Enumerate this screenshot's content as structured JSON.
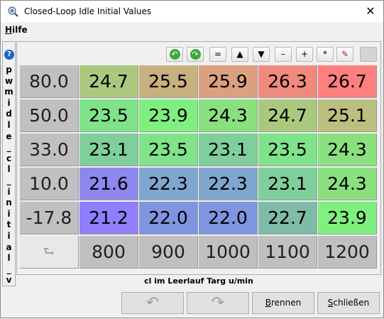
{
  "window": {
    "title": "Closed-Loop Idle Initial Values",
    "close_glyph": "✕",
    "app_icon": "gear-search-icon"
  },
  "menu": {
    "help_label": "Hilfe",
    "help_mnemonic": "H"
  },
  "sidebar": {
    "help_glyph": "?",
    "vertical_label": "pwmidle_cl_initial_values",
    "visible_chars": [
      "p",
      "w",
      "m",
      "i",
      "d",
      "l",
      "e",
      "_",
      "c",
      "l",
      "_",
      "i",
      "n",
      "i",
      "t",
      "i",
      "a",
      "l",
      "_",
      "v"
    ]
  },
  "toolbar": {
    "buttons": [
      {
        "name": "undo-green-icon",
        "glyph": "↶"
      },
      {
        "name": "redo-green-icon",
        "glyph": "↷"
      },
      {
        "name": "set-equal-button",
        "glyph": "="
      },
      {
        "name": "increase-button",
        "glyph": "▲"
      },
      {
        "name": "decrease-button",
        "glyph": "▼"
      },
      {
        "name": "subtract-button",
        "glyph": "–"
      },
      {
        "name": "add-button",
        "glyph": "+"
      },
      {
        "name": "multiply-button",
        "glyph": "*"
      },
      {
        "name": "interpolate-icon",
        "glyph": "✎"
      },
      {
        "name": "disabled-box",
        "glyph": ""
      }
    ]
  },
  "table": {
    "y_axis": [
      "80.0",
      "50.0",
      "33.0",
      "10.0",
      "-17.8"
    ],
    "x_axis": [
      "800",
      "900",
      "1000",
      "1100",
      "1200"
    ],
    "values": [
      [
        "24.7",
        "25.5",
        "25.9",
        "26.3",
        "26.7"
      ],
      [
        "23.5",
        "23.9",
        "24.3",
        "24.7",
        "25.1"
      ],
      [
        "23.1",
        "23.5",
        "23.1",
        "23.5",
        "24.3"
      ],
      [
        "21.6",
        "22.3",
        "22.3",
        "23.1",
        "24.3"
      ],
      [
        "21.2",
        "22.0",
        "22.0",
        "22.7",
        "23.9"
      ]
    ],
    "colors": [
      [
        "#aac97f",
        "#c8b07f",
        "#dba07f",
        "#f08a7f",
        "#ff7f7f"
      ],
      [
        "#7fe38a",
        "#7ff07f",
        "#8ae07f",
        "#aac97f",
        "#bbbf7f"
      ],
      [
        "#7fcf9a",
        "#7fe38a",
        "#7fcf9a",
        "#7fe38a",
        "#8ae07f"
      ],
      [
        "#8f87f0",
        "#7fa6cf",
        "#7fa6cf",
        "#7fcf9a",
        "#8ae07f"
      ],
      [
        "#8f7fff",
        "#7f95e0",
        "#7f95e0",
        "#7fbba8",
        "#7ff07f"
      ]
    ],
    "corner_glyph": "⮑",
    "x_axis_title": "cl im Leerlauf Targ u/min"
  },
  "buttons": {
    "undo_glyph": "↶",
    "redo_glyph": "↷",
    "burn_label": "Brennen",
    "burn_mnemonic": "B",
    "close_label": "Schließen",
    "close_mnemonic": "S"
  }
}
